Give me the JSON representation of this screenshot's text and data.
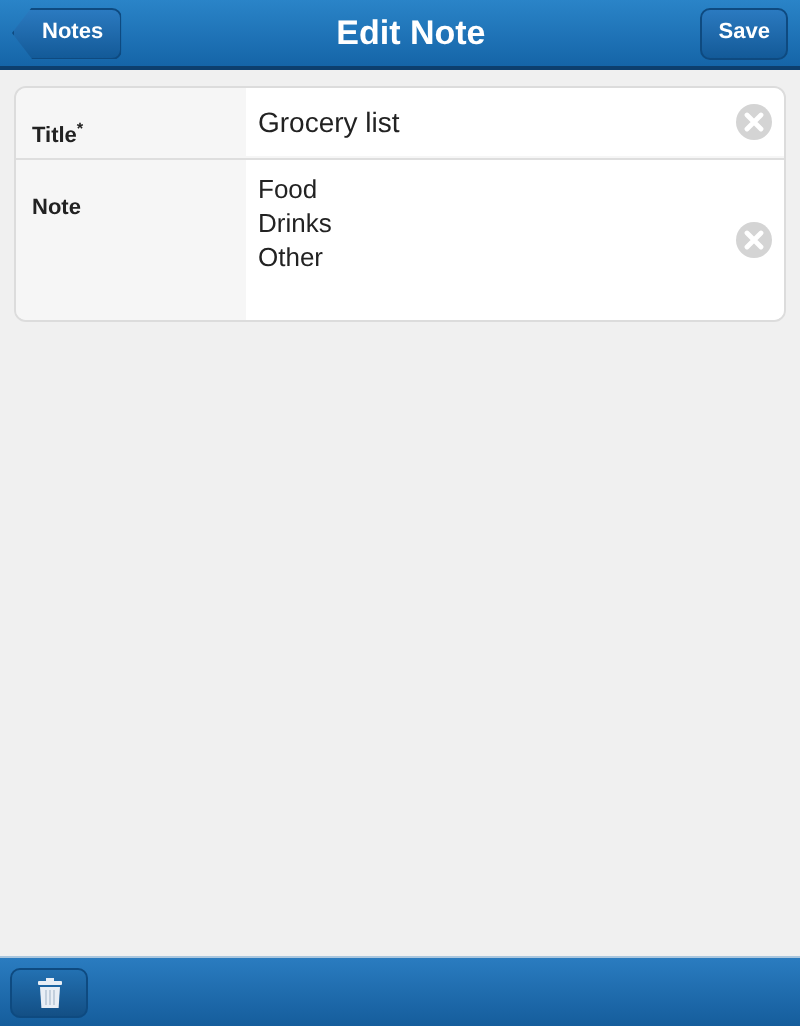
{
  "header": {
    "back_button": "Notes",
    "title": "Edit Note",
    "save_button": "Save"
  },
  "fields": [
    {
      "kind": "input",
      "label": "Title$^{*}$",
      "value": "Grocery list"
    },
    {
      "kind": "textarea",
      "label": "Note",
      "value": "Food\nDrinks\nOther"
    }
  ]
}
